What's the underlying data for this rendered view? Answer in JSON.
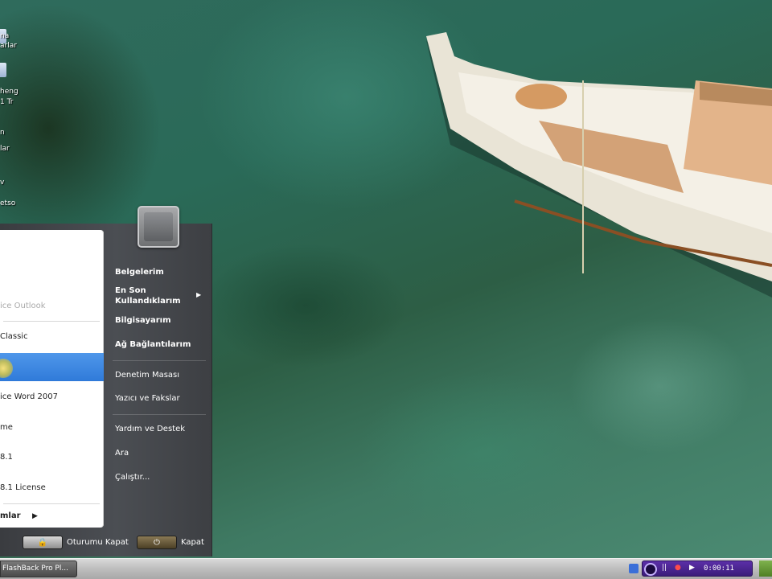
{
  "desktop": {
    "icons": [
      {
        "label": "na",
        "icon": "document-icon"
      },
      {
        "label": "arlar",
        "icon": "folder-icon"
      },
      {
        "label": "heng",
        "icon": "document-icon"
      },
      {
        "label": "1 Tr",
        "icon": "document-icon"
      },
      {
        "label": "n",
        "icon": "document-icon"
      },
      {
        "label": "lar",
        "icon": "folder-icon"
      },
      {
        "label": "v",
        "icon": "document-icon"
      },
      {
        "label": "etso",
        "icon": "document-icon"
      }
    ]
  },
  "start_menu": {
    "left_items": [
      {
        "label": "",
        "faded": false
      },
      {
        "label": "",
        "faded": false
      },
      {
        "label": "ice Outlook",
        "faded": true
      },
      {
        "label": "Classic",
        "faded": false
      },
      {
        "label": "",
        "faded": false,
        "selected": true
      },
      {
        "label": "ice Word 2007",
        "faded": false
      },
      {
        "label": "me",
        "faded": false
      },
      {
        "label": "8.1",
        "faded": false
      },
      {
        "label": "8.1 License",
        "faded": false
      }
    ],
    "all_programs": "mlar",
    "right_items": [
      {
        "label": "Belgelerim",
        "bold": true
      },
      {
        "label": "En Son",
        "bold": true
      },
      {
        "label": "Kullandıklarım",
        "bold": true
      },
      {
        "label": "Bilgisayarım",
        "bold": true
      },
      {
        "label": "Ağ Bağlantılarım",
        "bold": true
      },
      {
        "label": "Denetim Masası",
        "bold": false
      },
      {
        "label": "Yazıcı ve Fakslar",
        "bold": false
      },
      {
        "label": "Yardım ve Destek",
        "bold": false
      },
      {
        "label": "Ara",
        "bold": false
      },
      {
        "label": "Çalıştır...",
        "bold": false
      }
    ],
    "logoff_label": "Oturumu Kapat",
    "shutdown_label": "Kapat"
  },
  "taskbar": {
    "task_label": "FlashBack Pro Pl...",
    "recorder_time": "0:00:11",
    "recorder_controls": [
      "||",
      "●",
      "▶"
    ]
  },
  "colors": {
    "menu_dark": "#3a3c40",
    "selection_blue": "#2f7ad9",
    "recorder_purple": "#5b2fa8"
  }
}
